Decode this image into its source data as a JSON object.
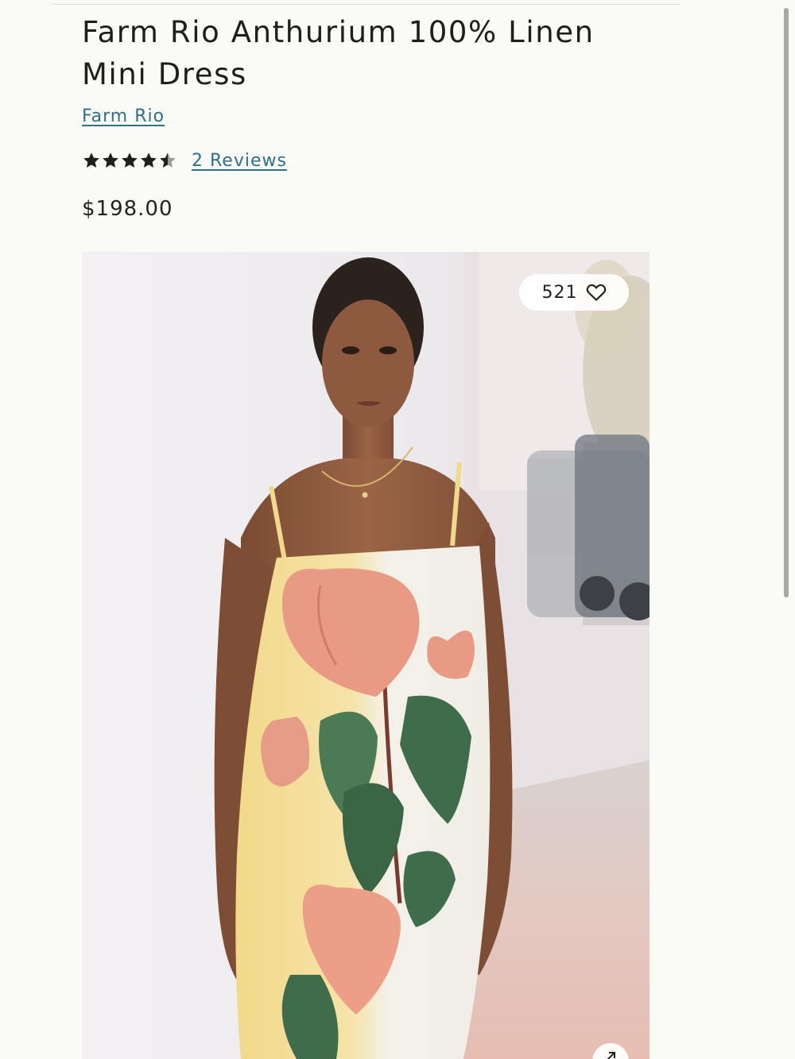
{
  "product": {
    "title": "Farm Rio Anthurium 100% Linen Mini Dress",
    "brand": "Farm Rio",
    "rating": 4.5,
    "rating_max": 5,
    "reviews_label": "2 Reviews",
    "price": "$198.00"
  },
  "image": {
    "likes": "521",
    "like_icon": "heart-outline-icon",
    "expand_icon": "arrow-up-right-icon"
  },
  "colors": {
    "link": "#2f6f88",
    "text": "#1e1e1e",
    "background": "#fafaf6"
  },
  "scroll": {
    "position_fraction": 0.0
  }
}
